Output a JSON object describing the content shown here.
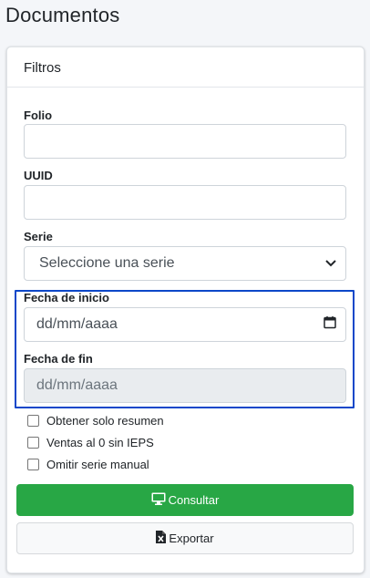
{
  "page": {
    "title": "Documentos"
  },
  "card": {
    "header": "Filtros"
  },
  "fields": {
    "folio": {
      "label": "Folio",
      "value": ""
    },
    "uuid": {
      "label": "UUID",
      "value": ""
    },
    "serie": {
      "label": "Serie",
      "selected": "Seleccione una serie"
    },
    "fecha_inicio": {
      "label": "Fecha de inicio",
      "value": "dd/mm/aaaa"
    },
    "fecha_fin": {
      "label": "Fecha de fin",
      "value": "dd/mm/aaaa"
    }
  },
  "checkboxes": [
    {
      "label": "Obtener solo resumen",
      "checked": false
    },
    {
      "label": "Ventas al 0 sin IEPS",
      "checked": false
    },
    {
      "label": "Omitir serie manual",
      "checked": false
    }
  ],
  "buttons": {
    "consultar": {
      "label": "Consultar",
      "icon": "monitor-icon"
    },
    "exportar": {
      "label": "Exportar",
      "icon": "excel-file-icon"
    }
  },
  "colors": {
    "primary_success": "#28a745",
    "highlight_border": "#0d47c9",
    "background": "#f4f6f9"
  }
}
